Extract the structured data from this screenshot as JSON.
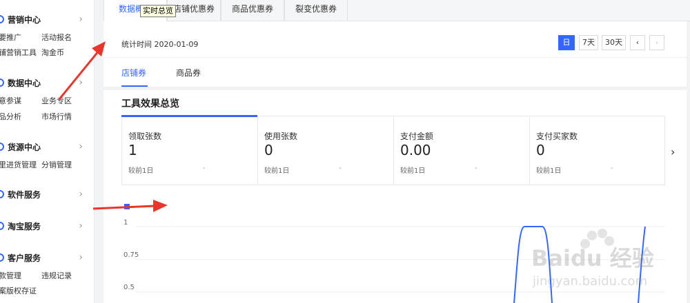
{
  "sidebar": {
    "sections": [
      {
        "title": "营销中心",
        "links": [
          "要推广",
          "活动报名",
          "铺营销工具",
          "淘金币"
        ]
      },
      {
        "title": "数据中心",
        "links": [
          "意参谋",
          "业务专区",
          "品分析",
          "市场行情"
        ]
      },
      {
        "title": "货源中心",
        "links": [
          "里进货管理",
          "分销管理"
        ]
      },
      {
        "title": "软件服务",
        "links": []
      },
      {
        "title": "淘宝服务",
        "links": []
      },
      {
        "title": "客户服务",
        "links": [
          "款管理",
          "违规记录",
          "案版权存证"
        ]
      }
    ],
    "chevron": "›"
  },
  "top_tabs": [
    "数据概览",
    "店铺优惠券",
    "商品优惠券",
    "裂变优惠券"
  ],
  "tooltip": "实时总览",
  "stat_time": "统计时间 2020-01-09",
  "range_buttons": [
    "日",
    "7天",
    "30天",
    "‹",
    "›"
  ],
  "sub_tabs": [
    "店铺券",
    "商品券"
  ],
  "section_title": "工具效果总览",
  "cards": [
    {
      "label": "领取张数",
      "value": "1",
      "compare": "较前1日",
      "delta": "-"
    },
    {
      "label": "使用张数",
      "value": "0",
      "compare": "较前1日",
      "delta": "-"
    },
    {
      "label": "支付金额",
      "value": "0.00",
      "compare": "较前1日",
      "delta": "-"
    },
    {
      "label": "支付买家数",
      "value": "0",
      "compare": "较前1日",
      "delta": "-"
    }
  ],
  "next_arrow": "›",
  "chart_data": {
    "type": "line",
    "y_ticks": [
      "1",
      "0.75",
      "0.5"
    ],
    "color": "#3366ff"
  },
  "watermark": {
    "brand": "Baidu 经验",
    "url": "jingyan.baidu.com"
  },
  "colors": {
    "accent": "#3366ff",
    "annotation": "#e8362d"
  }
}
